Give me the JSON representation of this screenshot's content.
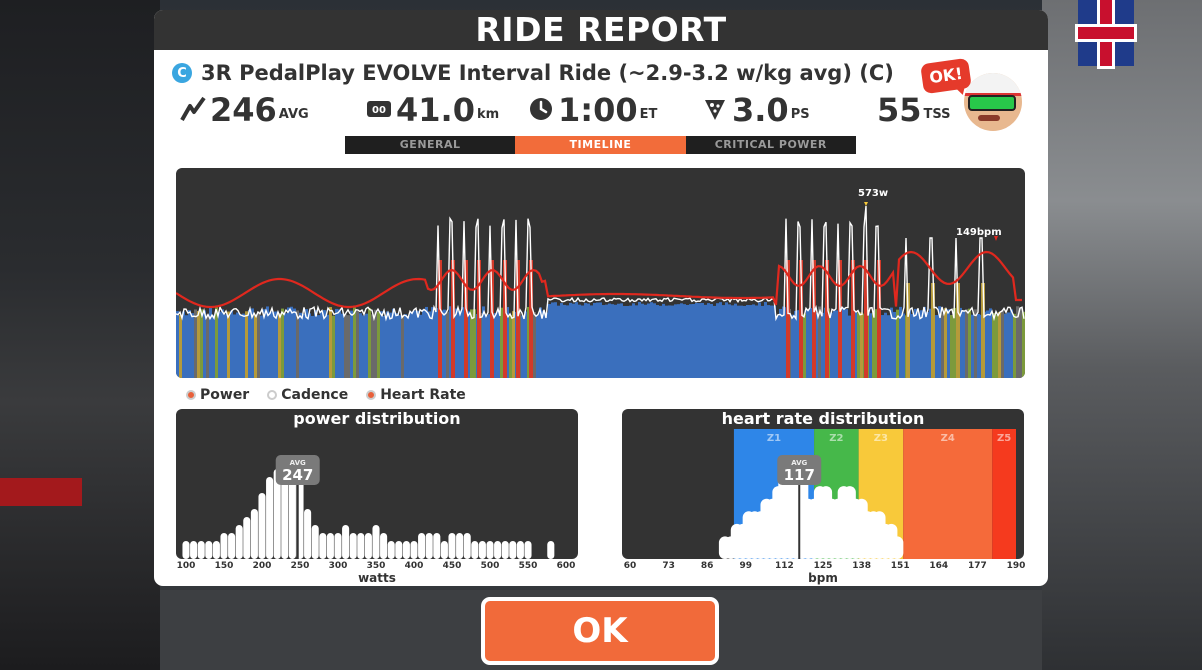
{
  "report": {
    "title": "RIDE REPORT",
    "route_badge": "C",
    "ride_name": "3R PedalPlay EVOLVE Interval Ride (~2.9-3.2 w/kg avg) (C)",
    "stats": [
      {
        "icon": "power-bolt-icon",
        "value": "246",
        "unit": "AVG"
      },
      {
        "icon": "odometer-icon",
        "value": "41.0",
        "unit": "km"
      },
      {
        "icon": "clock-icon",
        "value": "1:00",
        "unit": "ET"
      },
      {
        "icon": "pizza-slice-icon",
        "value": "3.0",
        "unit": "PS"
      },
      {
        "icon": "",
        "value": "55",
        "unit": "TSS"
      }
    ],
    "coach_bubble": "OK!"
  },
  "tabs": [
    {
      "label": "GENERAL",
      "active": false
    },
    {
      "label": "TIMELINE",
      "active": true
    },
    {
      "label": "CRITICAL POWER",
      "active": false
    }
  ],
  "timeline": {
    "peak_power_label": "573w",
    "peak_hr_label": "149bpm",
    "legend": [
      {
        "label": "Power",
        "color": "#e8603a"
      },
      {
        "label": "Cadence",
        "color": "#ffffff"
      },
      {
        "label": "Heart Rate",
        "color": "#e8603a"
      }
    ]
  },
  "power_distribution": {
    "title": "power distribution",
    "avg_label": "AVG",
    "avg_value": "247",
    "x_ticks": [
      "100",
      "150",
      "200",
      "250",
      "300",
      "350",
      "400",
      "450",
      "500",
      "550",
      "600"
    ],
    "x_label": "watts"
  },
  "hr_distribution": {
    "title": "heart rate distribution",
    "avg_label": "AVG",
    "avg_value": "117",
    "zones": [
      {
        "label": "Z1",
        "color": "#2e86e8"
      },
      {
        "label": "Z2",
        "color": "#46b84a"
      },
      {
        "label": "Z3",
        "color": "#f8c93a"
      },
      {
        "label": "Z4",
        "color": "#f56a3a"
      },
      {
        "label": "Z5",
        "color": "#f53a1e"
      }
    ],
    "x_ticks": [
      "60",
      "73",
      "86",
      "99",
      "112",
      "125",
      "138",
      "151",
      "164",
      "177",
      "190"
    ],
    "x_label": "bpm"
  },
  "ok_button": "OK",
  "colors": {
    "accent": "#f16a3a",
    "panel_dark": "#333333",
    "power_blue": "#3a6fbd",
    "hr_line": "#e0281e"
  },
  "chart_data": [
    {
      "type": "bar",
      "title": "power distribution",
      "xlabel": "watts",
      "x_ticks": [
        100,
        150,
        200,
        250,
        300,
        350,
        400,
        450,
        500,
        550,
        600
      ],
      "x": [
        100,
        110,
        120,
        130,
        140,
        150,
        160,
        170,
        180,
        190,
        200,
        210,
        220,
        230,
        240,
        250,
        260,
        270,
        280,
        290,
        300,
        310,
        320,
        330,
        340,
        350,
        360,
        370,
        380,
        390,
        400,
        410,
        420,
        430,
        440,
        450,
        460,
        470,
        480,
        490,
        500,
        510,
        520,
        530,
        540,
        550,
        560,
        570,
        580,
        590,
        600
      ],
      "values": [
        1,
        1,
        1,
        1,
        1,
        2,
        2,
        3,
        4,
        5,
        7,
        9,
        10,
        11,
        11,
        9,
        5,
        3,
        2,
        2,
        2,
        3,
        2,
        2,
        2,
        3,
        2,
        1,
        1,
        1,
        1,
        2,
        2,
        2,
        1,
        2,
        2,
        2,
        1,
        1,
        1,
        1,
        1,
        1,
        1,
        1,
        0,
        0,
        1,
        0,
        0
      ],
      "avg": 247
    },
    {
      "type": "bar",
      "title": "heart rate distribution",
      "xlabel": "bpm",
      "x_ticks": [
        60,
        73,
        86,
        99,
        112,
        125,
        138,
        151,
        164,
        177,
        190
      ],
      "x": [
        92,
        94,
        96,
        98,
        100,
        102,
        104,
        106,
        108,
        110,
        112,
        114,
        116,
        118,
        120,
        122,
        124,
        126,
        128,
        130,
        132,
        134,
        136,
        138,
        140,
        142,
        144,
        146,
        148,
        150
      ],
      "values": [
        1,
        1,
        2,
        2,
        3,
        3,
        3,
        4,
        4,
        5,
        6,
        7,
        7,
        6,
        4,
        4,
        5,
        5,
        4,
        4,
        5,
        5,
        4,
        4,
        3,
        3,
        3,
        2,
        2,
        1
      ],
      "avg": 117,
      "zones": [
        "Z1",
        "Z2",
        "Z3",
        "Z4",
        "Z5"
      ]
    }
  ]
}
